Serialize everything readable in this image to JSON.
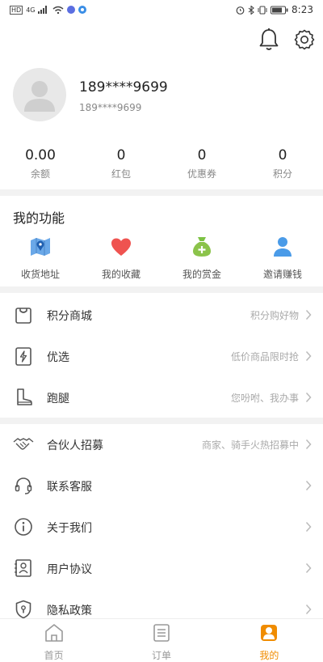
{
  "status_bar": {
    "time": "8:23",
    "battery": "",
    "network": "4G"
  },
  "profile": {
    "name": "189****9699",
    "sub": "189****9699"
  },
  "stats": [
    {
      "value": "0.00",
      "label": "余额"
    },
    {
      "value": "0",
      "label": "红包"
    },
    {
      "value": "0",
      "label": "优惠券"
    },
    {
      "value": "0",
      "label": "积分"
    }
  ],
  "functions": {
    "title": "我的功能",
    "items": [
      {
        "label": "收货地址",
        "icon": "map-icon",
        "color": "#4a90d9"
      },
      {
        "label": "我的收藏",
        "icon": "heart-icon",
        "color": "#ef5350"
      },
      {
        "label": "我的赏金",
        "icon": "money-bag-icon",
        "color": "#7cc243"
      },
      {
        "label": "邀请赚钱",
        "icon": "person-icon",
        "color": "#4a9be8"
      }
    ]
  },
  "menu_group_1": [
    {
      "label": "积分商城",
      "hint": "积分购好物",
      "icon": "shopping-bag-icon"
    },
    {
      "label": "优选",
      "hint": "低价商品限时抢",
      "icon": "flash-icon"
    },
    {
      "label": "跑腿",
      "hint": "您吩咐、我办事",
      "icon": "boot-icon"
    }
  ],
  "menu_group_2": [
    {
      "label": "合伙人招募",
      "hint": "商家、骑手火热招募中",
      "icon": "handshake-icon"
    },
    {
      "label": "联系客服",
      "hint": "",
      "icon": "headset-icon"
    },
    {
      "label": "关于我们",
      "hint": "",
      "icon": "info-icon"
    },
    {
      "label": "用户协议",
      "hint": "",
      "icon": "contract-icon"
    },
    {
      "label": "隐私政策",
      "hint": "",
      "icon": "shield-icon"
    }
  ],
  "tabbar": [
    {
      "label": "首页",
      "icon": "home-icon",
      "active": false
    },
    {
      "label": "订单",
      "icon": "list-icon",
      "active": false
    },
    {
      "label": "我的",
      "icon": "user-icon",
      "active": true
    }
  ],
  "colors": {
    "accent": "#f08c00",
    "separator": "#f2f2f2"
  }
}
